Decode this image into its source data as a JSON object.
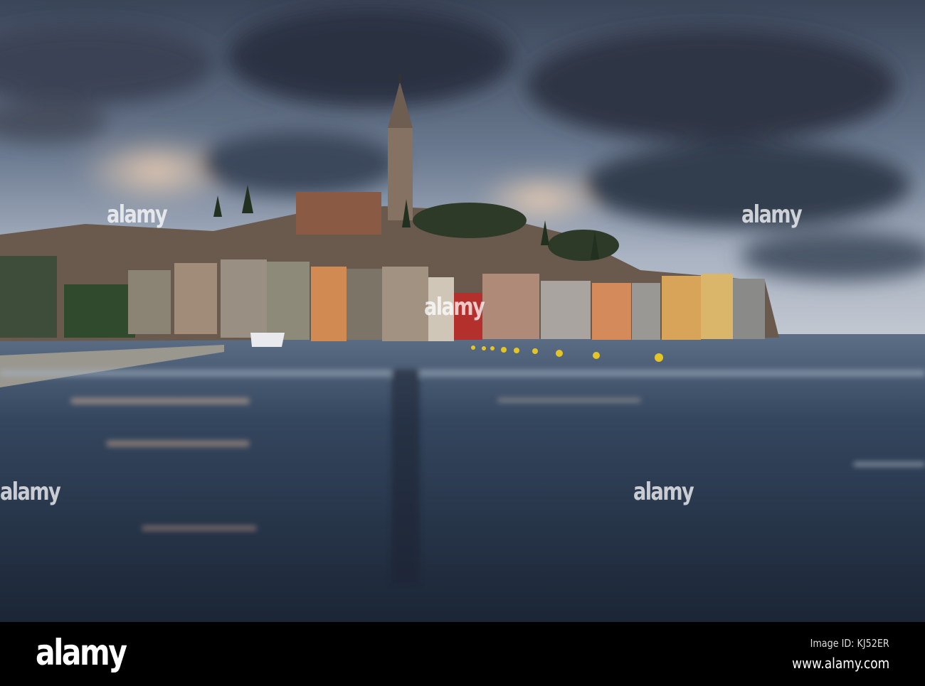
{
  "photo": {
    "colors": {
      "sky_dark": "#2c3648",
      "sky_light": "#9aa8bb",
      "sunset": "#e9b39a",
      "water": "#1e2a3a",
      "buoy": "#e5c526"
    }
  },
  "watermark": {
    "text": "alamy"
  },
  "footer": {
    "logo": "alamy",
    "image_id": "Image ID: KJ52ER",
    "website": "www.alamy.com"
  }
}
